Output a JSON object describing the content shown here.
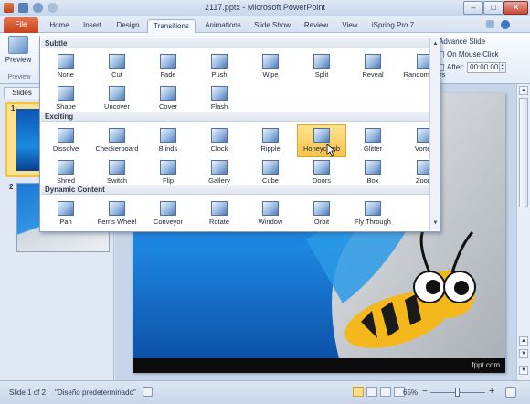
{
  "window": {
    "title": "2117.pptx - Microsoft PowerPoint",
    "controls": [
      "–",
      "□",
      "✕"
    ]
  },
  "tabs": {
    "file": "File",
    "items": [
      "Home",
      "Insert",
      "Design",
      "Transitions",
      "Animations",
      "Slide Show",
      "Review",
      "View",
      "iSpring Pro 7"
    ],
    "active": "Transitions"
  },
  "ribbon": {
    "preview_label": "Preview",
    "preview_group_label": "Preview",
    "advance_slide": "Advance Slide",
    "on_mouse_click": "On Mouse Click",
    "after_label": "After:",
    "after_value": "00:00.00"
  },
  "left_pane": {
    "tab_label": "Slides",
    "slide_numbers": [
      "1",
      "2"
    ]
  },
  "gallery": {
    "sections": [
      {
        "name": "Subtle",
        "items": [
          "None",
          "Cut",
          "Fade",
          "Push",
          "Wipe",
          "Split",
          "Reveal",
          "Random Bars",
          "Shape",
          "Uncover",
          "Cover",
          "Flash"
        ]
      },
      {
        "name": "Exciting",
        "items": [
          "Dissolve",
          "Checkerboard",
          "Blinds",
          "Clock",
          "Ripple",
          "Honeycomb",
          "Glitter",
          "Vortex",
          "Shred",
          "Switch",
          "Flip",
          "Gallery",
          "Cube",
          "Doors",
          "Box",
          "Zoom"
        ]
      },
      {
        "name": "Dynamic Content",
        "items": [
          "Pan",
          "Ferris Wheel",
          "Conveyor",
          "Rotate",
          "Window",
          "Orbit",
          "Fly Through"
        ]
      }
    ],
    "selected": "Honeycomb"
  },
  "slide": {
    "watermark": "fppt.com"
  },
  "status": {
    "slide_info": "Slide 1 of 2",
    "theme": "\"Diseño predeterminado\"",
    "zoom": "65%",
    "zoom_minus": "−",
    "zoom_plus": "+"
  },
  "colors": {
    "file_tab": "#d0532b",
    "selection": "#f6c34b",
    "slide_blue": "#1a7fdc"
  }
}
